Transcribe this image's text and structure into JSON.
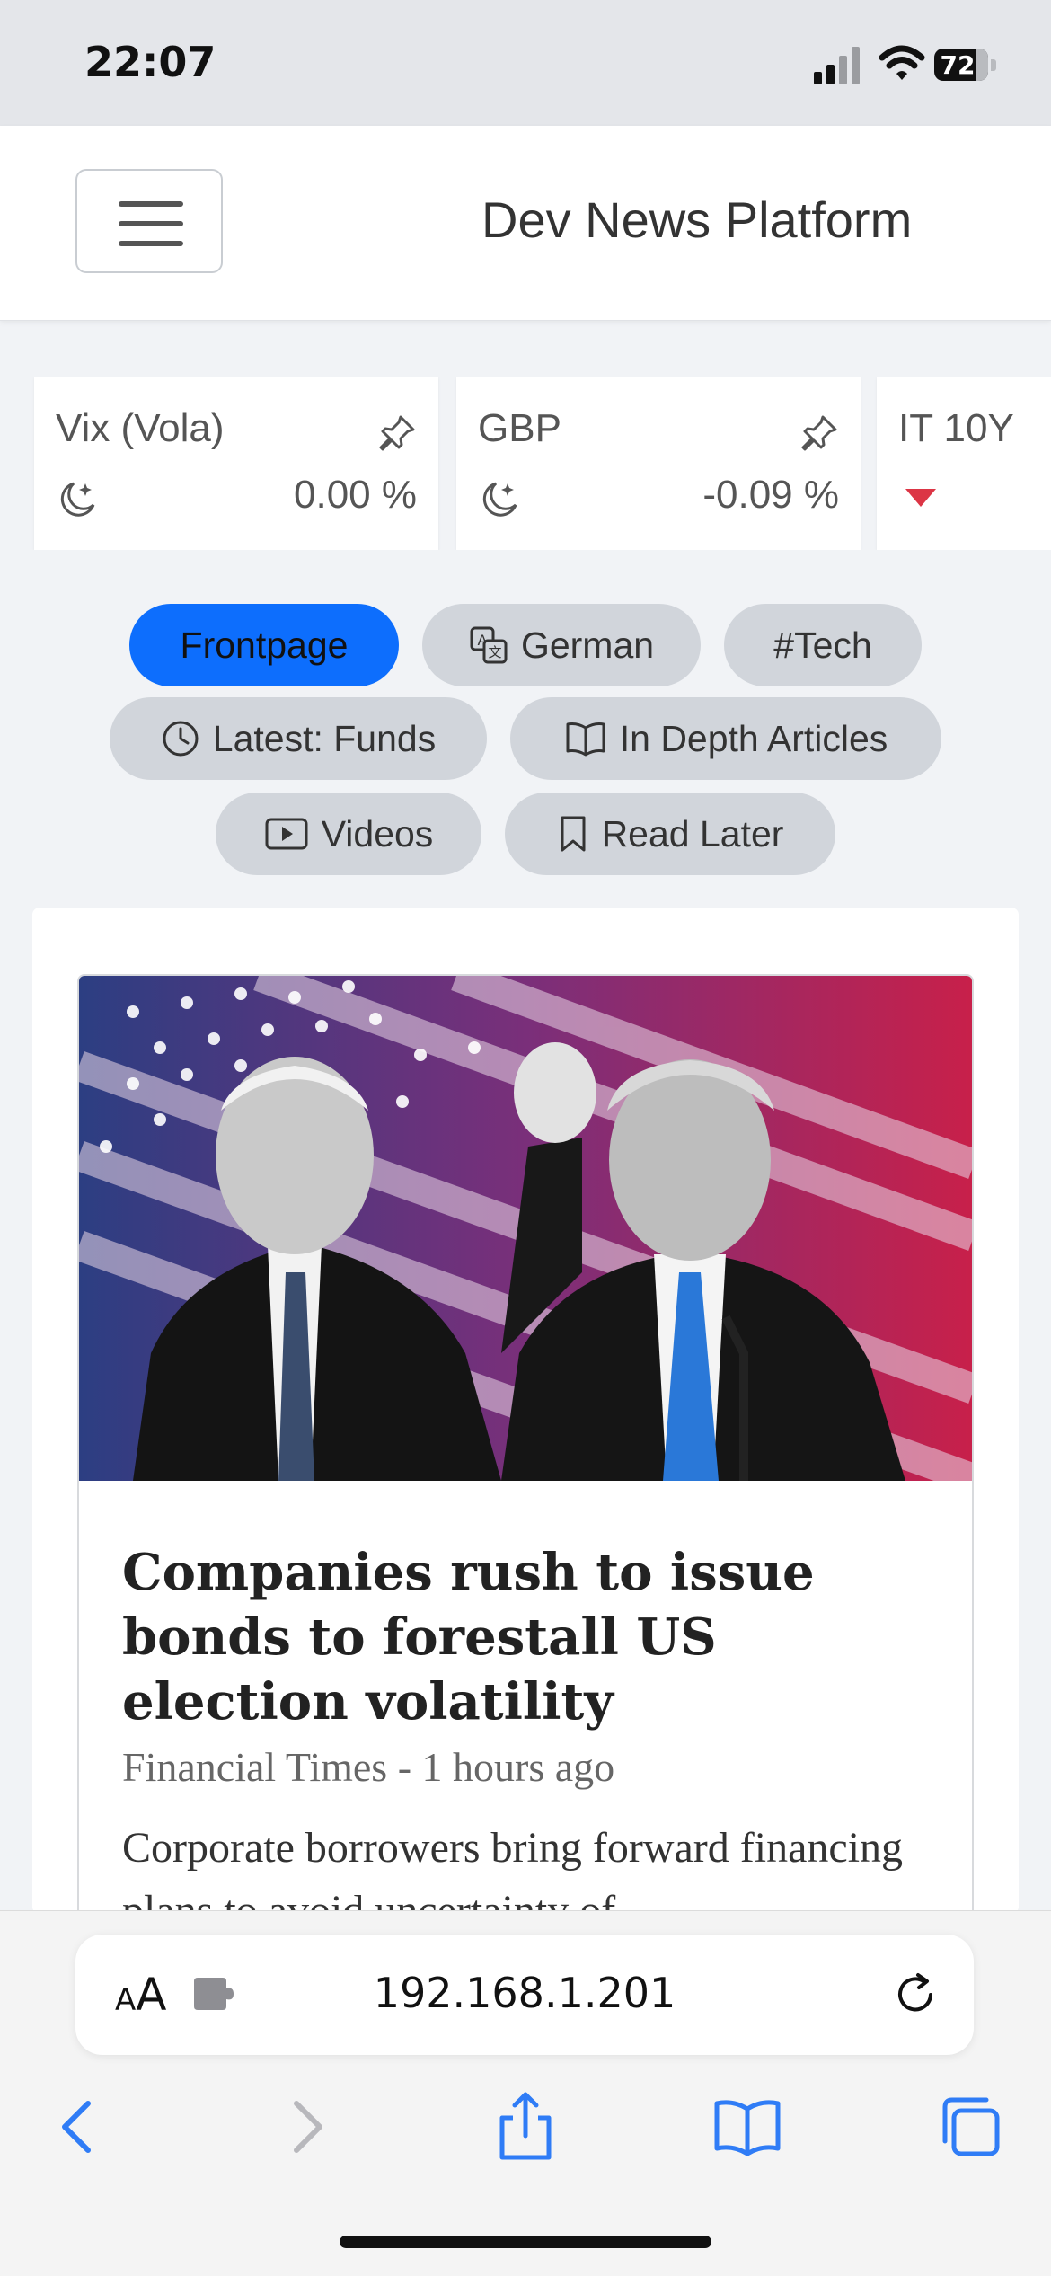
{
  "status": {
    "time": "22:07",
    "battery": "72"
  },
  "nav": {
    "brand": "Dev News Platform"
  },
  "tickers": [
    {
      "name": "Vix (Vola)",
      "value": "0.00 %"
    },
    {
      "name": "GBP",
      "value": "-0.09 %"
    },
    {
      "name": "IT 10Y",
      "value": ""
    }
  ],
  "filters": {
    "frontpage": "Frontpage",
    "german": "German",
    "tech": "#Tech",
    "latest": "Latest: Funds",
    "indepth": "In Depth Articles",
    "videos": "Videos",
    "readlater": "Read Later"
  },
  "article": {
    "headline": "Companies rush to issue bonds to forestall US election volatility",
    "meta": "Financial Times - 1 hours ago",
    "summary": "Corporate borrowers bring forward financing plans to avoid uncertainty of"
  },
  "browser": {
    "url": "192.168.1.201",
    "aa_small": "A",
    "aa_large": "A"
  },
  "colors": {
    "accent": "#0d6efd",
    "pill": "#d1d5db",
    "down": "#dc3545",
    "ios_blue": "#2f7cf6"
  }
}
